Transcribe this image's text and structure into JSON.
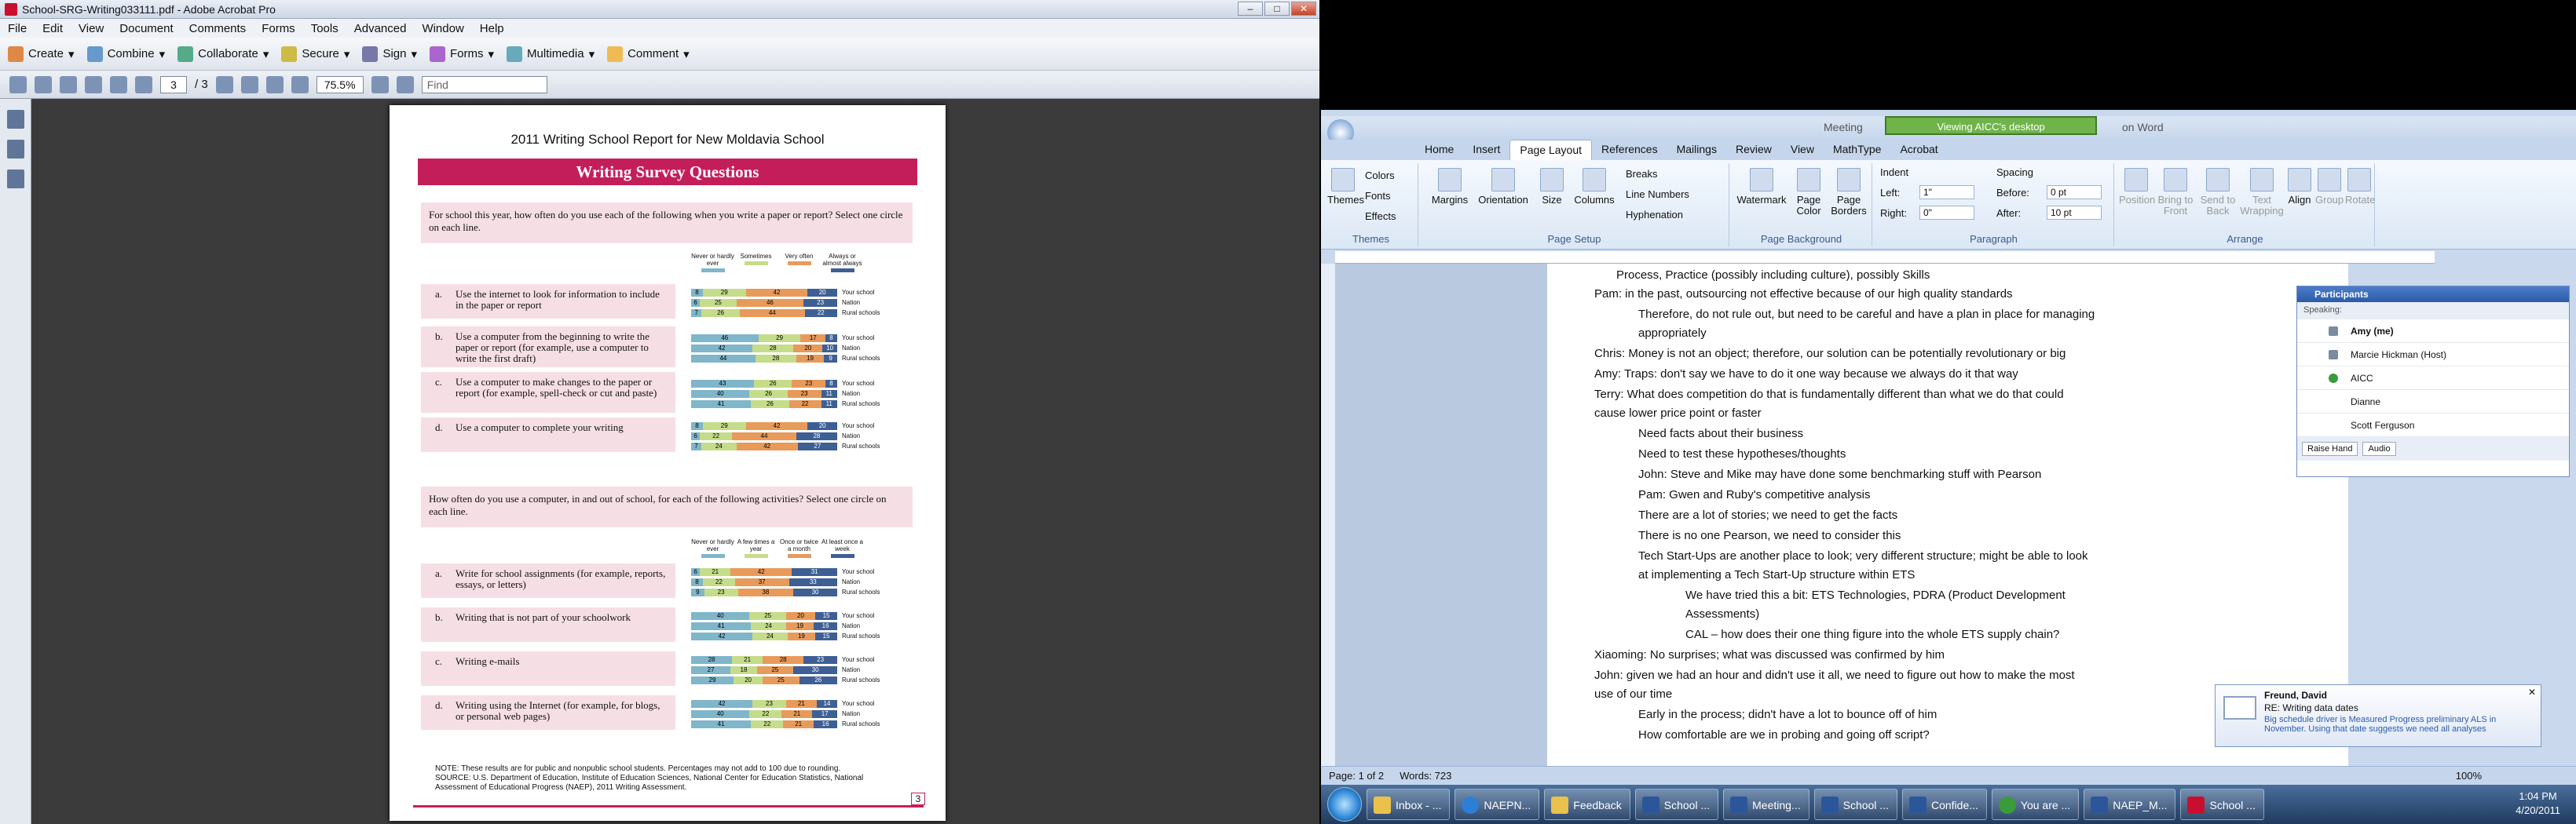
{
  "acrobat": {
    "title": "School-SRG-Writing033111.pdf - Adobe Acrobat Pro",
    "menu": [
      "File",
      "Edit",
      "View",
      "Document",
      "Comments",
      "Forms",
      "Tools",
      "Advanced",
      "Window",
      "Help"
    ],
    "toolbar": [
      "Create",
      "Combine",
      "Collaborate",
      "Secure",
      "Sign",
      "Forms",
      "Multimedia",
      "Comment"
    ],
    "page_current": "3",
    "page_total": "/ 3",
    "zoom": "75.5%",
    "find_placeholder": "Find"
  },
  "pdf": {
    "title": "2011 Writing School Report for New Moldavia School",
    "banner": "Writing Survey Questions",
    "q1": "For school this year, how often do you use each of the following when you write a paper or report? Select one circle on each line.",
    "legend1": [
      "Never or hardly ever",
      "Sometimes",
      "Very often",
      "Always or almost always"
    ],
    "items1": [
      {
        "letter": "a.",
        "text": "Use the internet to look for information to include in the paper or report"
      },
      {
        "letter": "b.",
        "text": "Use a computer from the beginning to write the paper or report (for example, use a computer to write the first draft)"
      },
      {
        "letter": "c.",
        "text": "Use a computer to make changes to the paper or report (for example, spell-check or cut and paste)"
      },
      {
        "letter": "d.",
        "text": "Use a computer to complete your writing"
      }
    ],
    "q2": "How often do you use a computer, in and out of school, for each of the following activities? Select one circle on each line.",
    "legend2": [
      "Never or hardly ever",
      "A few times a year",
      "Once or twice a month",
      "At least once a week"
    ],
    "items2": [
      {
        "letter": "a.",
        "text": "Write for school assignments (for example, reports, essays, or letters)"
      },
      {
        "letter": "b.",
        "text": "Writing that is not part of your schoolwork"
      },
      {
        "letter": "c.",
        "text": "Writing e-mails"
      },
      {
        "letter": "d.",
        "text": "Writing using the Internet (for example, for blogs, or personal web pages)"
      }
    ],
    "row_labels": [
      "Your school",
      "Nation",
      "Rural schools"
    ],
    "note": "NOTE: These results are for public and nonpublic school students. Percentages may not add to 100 due to rounding.",
    "source": "SOURCE: U.S. Department of Education, Institute of Education Sciences, National Center for Education Statistics, National Assessment of Educational Progress (NAEP), 2011 Writing Assessment.",
    "page_number": "3",
    "colors": {
      "c1": "#7fb6c9",
      "c2": "#c5dc8a",
      "c3": "#e89a5a",
      "c4": "#3e5f94"
    }
  },
  "word": {
    "banner": "Viewing AICC's desktop",
    "title_left": "Meeting",
    "title_right": "on Word",
    "tabs": [
      "Home",
      "Insert",
      "Page Layout",
      "References",
      "Mailings",
      "Review",
      "View",
      "MathType",
      "Acrobat"
    ],
    "groups": [
      "Themes",
      "Page Setup",
      "Page Background",
      "Paragraph",
      "Arrange"
    ],
    "theme_btns": [
      "Themes",
      "Colors",
      "Fonts",
      "Effects"
    ],
    "page_setup": [
      "Margins",
      "Orientation",
      "Size",
      "Columns",
      "Breaks",
      "Line Numbers",
      "Hyphenation"
    ],
    "page_bg": [
      "Watermark",
      "Page Color",
      "Page Borders"
    ],
    "indent_label": "Indent",
    "indent_left_label": "Left:",
    "indent_left": "1\"",
    "indent_right_label": "Right:",
    "indent_right": "0\"",
    "spacing_label": "Spacing",
    "spacing_before_label": "Before:",
    "spacing_before": "0 pt",
    "spacing_after_label": "After:",
    "spacing_after": "10 pt",
    "arrange": [
      "Position",
      "Bring to Front",
      "Send to Back",
      "Text Wrapping",
      "Align",
      "Group",
      "Rotate"
    ],
    "lines": [
      "Process, Practice (possibly including culture), possibly Skills",
      "Pam: in the past, outsourcing not effective because of our high quality standards",
      "Therefore, do not rule out, but need to be careful and have a plan in place for managing",
      "appropriately",
      "Chris: Money is not an object; therefore, our solution can be potentially revolutionary or big",
      "Amy: Traps: don't say we have to do it one way because we always do it that way",
      "Terry: What does competition do that is fundamentally different than what we do that could",
      "cause lower price point or faster",
      "Need facts about their business",
      "Need to test these hypotheses/thoughts",
      "John: Steve and Mike may have done some benchmarking  stuff with Pearson",
      "Pam: Gwen and Ruby's competitive analysis",
      "There are a lot of stories; we need to get the facts",
      "There is no one Pearson, we need to consider this",
      "Tech Start-Ups are another place to look; very different structure; might be able to look",
      "at implementing  a Tech Start-Up structure  within ETS",
      "We have tried this a bit: ETS Technologies, PDRA (Product Development",
      "Assessments)",
      "CAL – how does their one thing figure into the whole ETS supply chain?",
      "Xiaoming: No surprises;  what was discussed was confirmed by him",
      "John: given we had an hour and didn't use it all, we need to figure out how to make the most",
      "use of our time",
      "Early in the process; didn't have a lot to bounce off of him",
      "How comfortable are we in probing and going off script?"
    ],
    "participants": {
      "title": "Participants",
      "speaking": "Speaking:",
      "people": [
        "Amy (me)",
        "Marcie Hickman (Host)",
        "AICC",
        "Dianne",
        "Scott Ferguson"
      ],
      "raise_hand": "Raise Hand",
      "audio": "Audio"
    },
    "toast": {
      "from": "Freund, David",
      "subject": "RE: Writing data dates",
      "body": "Big schedule driver is Measured Progress preliminary ALS in November. Using that date suggests we need all analyses"
    },
    "status_page": "Page: 1 of 2",
    "status_words": "Words: 723",
    "zoom": "100%"
  },
  "taskbar": {
    "items": [
      "Inbox - ...",
      "NAEPN...",
      "Feedback",
      "School ...",
      "Meeting...",
      "School ...",
      "Confide...",
      "You are ...",
      "NAEP_M...",
      "School ..."
    ],
    "time": "1:04 PM",
    "date": "4/20/2011"
  },
  "chart_data": [
    {
      "type": "bar",
      "title": "",
      "series_labels": [
        "Never or hardly ever",
        "Sometimes",
        "Very often",
        "Always or almost always"
      ],
      "groups": [
        {
          "item": "a",
          "rows": [
            [
              8,
              29,
              42,
              20
            ],
            [
              6,
              25,
              46,
              23
            ],
            [
              7,
              26,
              44,
              22
            ]
          ]
        },
        {
          "item": "b",
          "rows": [
            [
              46,
              29,
              17,
              8
            ],
            [
              42,
              28,
              20,
              10
            ],
            [
              44,
              28,
              19,
              9
            ]
          ]
        },
        {
          "item": "c",
          "rows": [
            [
              43,
              26,
              23,
              8
            ],
            [
              40,
              26,
              23,
              11
            ],
            [
              41,
              26,
              22,
              11
            ]
          ]
        },
        {
          "item": "d",
          "rows": [
            [
              8,
              29,
              42,
              20
            ],
            [
              6,
              22,
              44,
              28
            ],
            [
              7,
              24,
              42,
              27
            ]
          ]
        }
      ]
    },
    {
      "type": "bar",
      "title": "",
      "series_labels": [
        "Never or hardly ever",
        "A few times a year",
        "Once or twice a month",
        "At least once a week"
      ],
      "groups": [
        {
          "item": "a",
          "rows": [
            [
              6,
              21,
              42,
              31
            ],
            [
              8,
              22,
              37,
              33
            ],
            [
              9,
              23,
              38,
              30
            ]
          ]
        },
        {
          "item": "b",
          "rows": [
            [
              40,
              25,
              20,
              15
            ],
            [
              41,
              24,
              19,
              16
            ],
            [
              42,
              24,
              19,
              15
            ]
          ]
        },
        {
          "item": "c",
          "rows": [
            [
              28,
              21,
              28,
              23
            ],
            [
              27,
              18,
              25,
              30
            ],
            [
              29,
              20,
              25,
              26
            ]
          ]
        },
        {
          "item": "d",
          "rows": [
            [
              42,
              23,
              21,
              14
            ],
            [
              40,
              22,
              21,
              17
            ],
            [
              41,
              22,
              21,
              16
            ]
          ]
        }
      ]
    }
  ]
}
